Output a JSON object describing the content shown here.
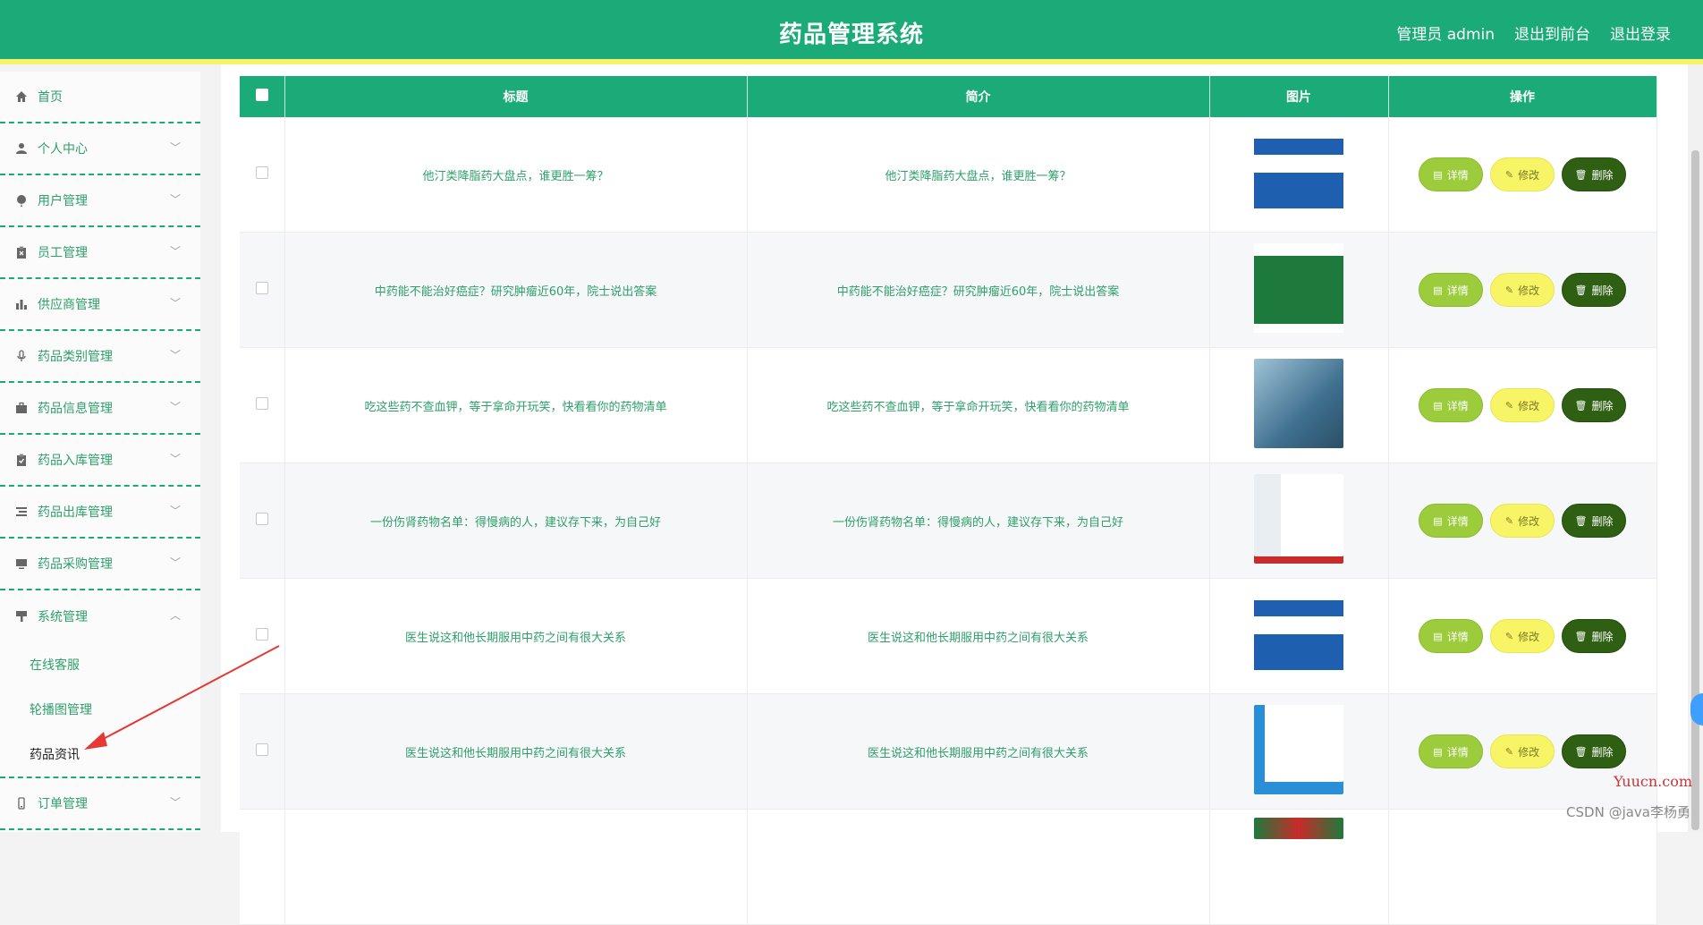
{
  "header": {
    "title": "药品管理系统",
    "admin_label": "管理员 admin",
    "front_link": "退出到前台",
    "logout_link": "退出登录"
  },
  "sidebar": {
    "items": [
      {
        "label": "首页",
        "icon": "home-icon"
      },
      {
        "label": "个人中心",
        "icon": "user-icon"
      },
      {
        "label": "用户管理",
        "icon": "balloon-icon"
      },
      {
        "label": "员工管理",
        "icon": "clipboard-x-icon"
      },
      {
        "label": "供应商管理",
        "icon": "bar-chart-icon"
      },
      {
        "label": "药品类别管理",
        "icon": "microphone-icon"
      },
      {
        "label": "药品信息管理",
        "icon": "briefcase-icon"
      },
      {
        "label": "药品入库管理",
        "icon": "clipboard-check-icon"
      },
      {
        "label": "药品出库管理",
        "icon": "list-icon"
      },
      {
        "label": "药品采购管理",
        "icon": "monitor-icon"
      },
      {
        "label": "系统管理",
        "icon": "brush-icon"
      },
      {
        "label": "订单管理",
        "icon": "phone-icon"
      }
    ],
    "submenu": [
      "在线客服",
      "轮播图管理",
      "药品资讯"
    ]
  },
  "table": {
    "headers": [
      "标题",
      "简介",
      "图片",
      "操作"
    ],
    "rows": [
      {
        "title": "他汀类降脂药大盘点，谁更胜一筹？",
        "intro": "他汀类降脂药大盘点，谁更胜一筹？"
      },
      {
        "title": "中药能不能治好癌症？研究肿瘤近60年，院士说出答案",
        "intro": "中药能不能治好癌症？研究肿瘤近60年，院士说出答案"
      },
      {
        "title": "吃这些药不查血钾，等于拿命开玩笑，快看看你的药物清单",
        "intro": "吃这些药不查血钾，等于拿命开玩笑，快看看你的药物清单"
      },
      {
        "title": "一份伤肾药物名单：得慢病的人，建议存下来，为自己好",
        "intro": "一份伤肾药物名单：得慢病的人，建议存下来，为自己好"
      },
      {
        "title": "医生说这和他长期服用中药之间有很大关系",
        "intro": "医生说这和他长期服用中药之间有很大关系"
      },
      {
        "title": "医生说这和他长期服用中药之间有很大关系",
        "intro": "医生说这和他长期服用中药之间有很大关系"
      }
    ],
    "buttons": {
      "detail": "详情",
      "edit": "修改",
      "delete": "删除"
    }
  },
  "watermark": {
    "site": "Yuucn.com",
    "csdn": "CSDN @java李杨勇"
  },
  "colors": {
    "primary": "#1bab79",
    "accent_yellow": "#f6f36a",
    "detail_btn": "#9ccc3b",
    "edit_btn": "#f7f565",
    "delete_btn": "#2f5f12",
    "annotation_arrow": "#e53935"
  }
}
